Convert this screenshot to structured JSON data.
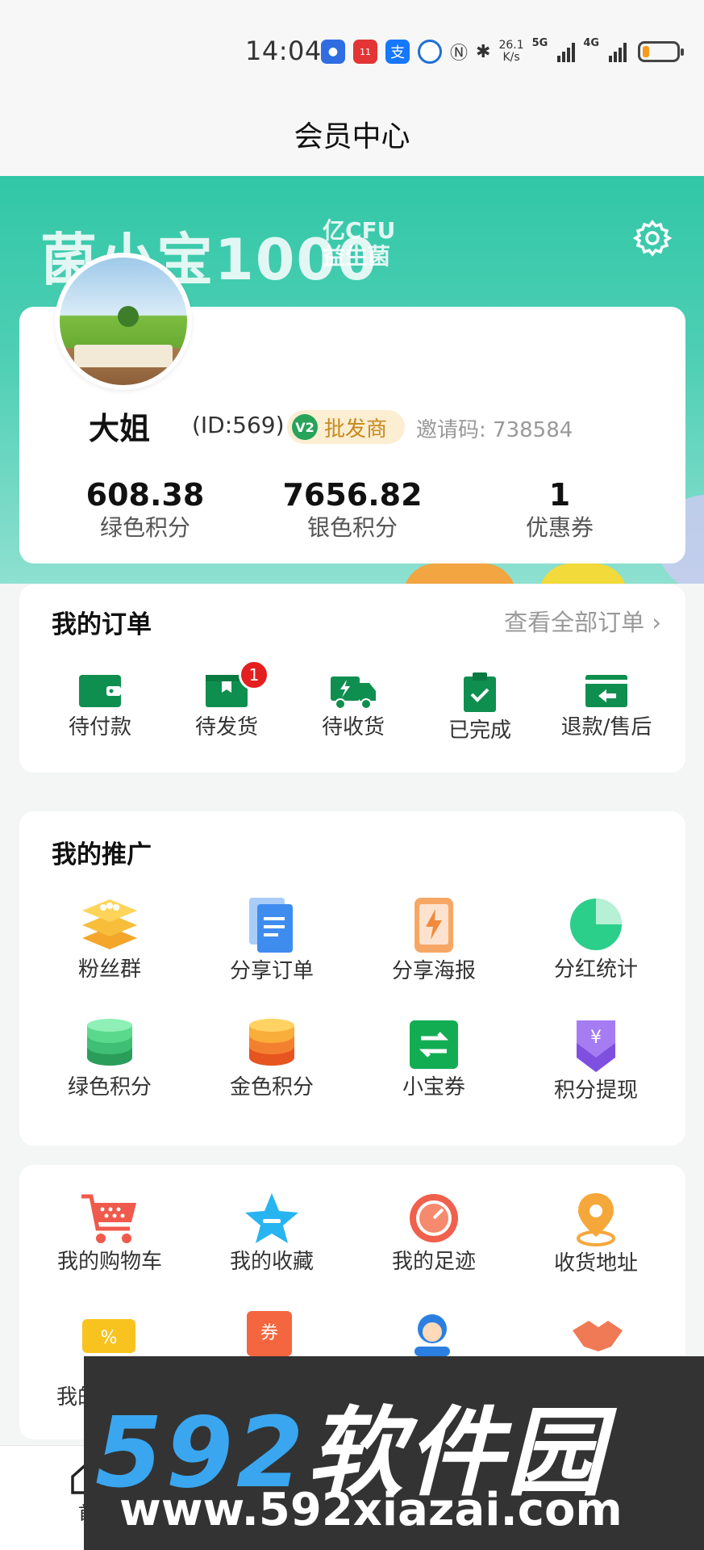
{
  "status_bar": {
    "time": "14:04",
    "speed_top": "26.1",
    "speed_unit": "K/s",
    "net1": "5G",
    "net2": "4G"
  },
  "header": {
    "title": "会员中心"
  },
  "banner": {
    "brand": "菌小宝1000",
    "brand_unit": "亿CFU",
    "brand_sub": "益生菌"
  },
  "profile": {
    "name": "大姐",
    "id_text": "(ID:569)",
    "level_code": "V2",
    "level_name": "批发商",
    "invite_label": "邀请码:",
    "invite_code": "738584",
    "stats": [
      {
        "value": "608.38",
        "label": "绿色积分"
      },
      {
        "value": "7656.82",
        "label": "银色积分"
      },
      {
        "value": "1",
        "label": "优惠券"
      }
    ]
  },
  "orders": {
    "title": "我的订单",
    "view_all": "查看全部订单",
    "items": [
      {
        "label": "待付款",
        "icon": "wallet-icon"
      },
      {
        "label": "待发货",
        "icon": "box-icon",
        "badge": "1"
      },
      {
        "label": "待收货",
        "icon": "truck-icon"
      },
      {
        "label": "已完成",
        "icon": "clipboard-check-icon"
      },
      {
        "label": "退款/售后",
        "icon": "refund-icon"
      }
    ]
  },
  "promotion": {
    "title": "我的推广",
    "items": [
      {
        "label": "粉丝群",
        "icon": "fans-group-icon"
      },
      {
        "label": "分享订单",
        "icon": "share-order-icon"
      },
      {
        "label": "分享海报",
        "icon": "share-poster-icon"
      },
      {
        "label": "分红统计",
        "icon": "pie-chart-icon"
      },
      {
        "label": "绿色积分",
        "icon": "green-coins-icon"
      },
      {
        "label": "金色积分",
        "icon": "gold-coins-icon"
      },
      {
        "label": "小宝券",
        "icon": "exchange-icon"
      },
      {
        "label": "积分提现",
        "icon": "withdraw-icon"
      }
    ]
  },
  "tools": {
    "items": [
      {
        "label": "我的购物车",
        "icon": "cart-icon"
      },
      {
        "label": "我的收藏",
        "icon": "star-icon"
      },
      {
        "label": "我的足迹",
        "icon": "footprint-icon"
      },
      {
        "label": "收货地址",
        "icon": "location-icon"
      }
    ],
    "partial_label": "我的"
  },
  "bottom_nav": {
    "home_label": "首"
  },
  "watermark": {
    "big": "592",
    "big_cn": "软件园",
    "url": "www.592xiazai.com"
  },
  "colors": {
    "accent_green": "#0f8f4f",
    "banner_teal": "#31c7a6",
    "badge_red": "#e41f1f",
    "level_gold": "#c8891e"
  }
}
